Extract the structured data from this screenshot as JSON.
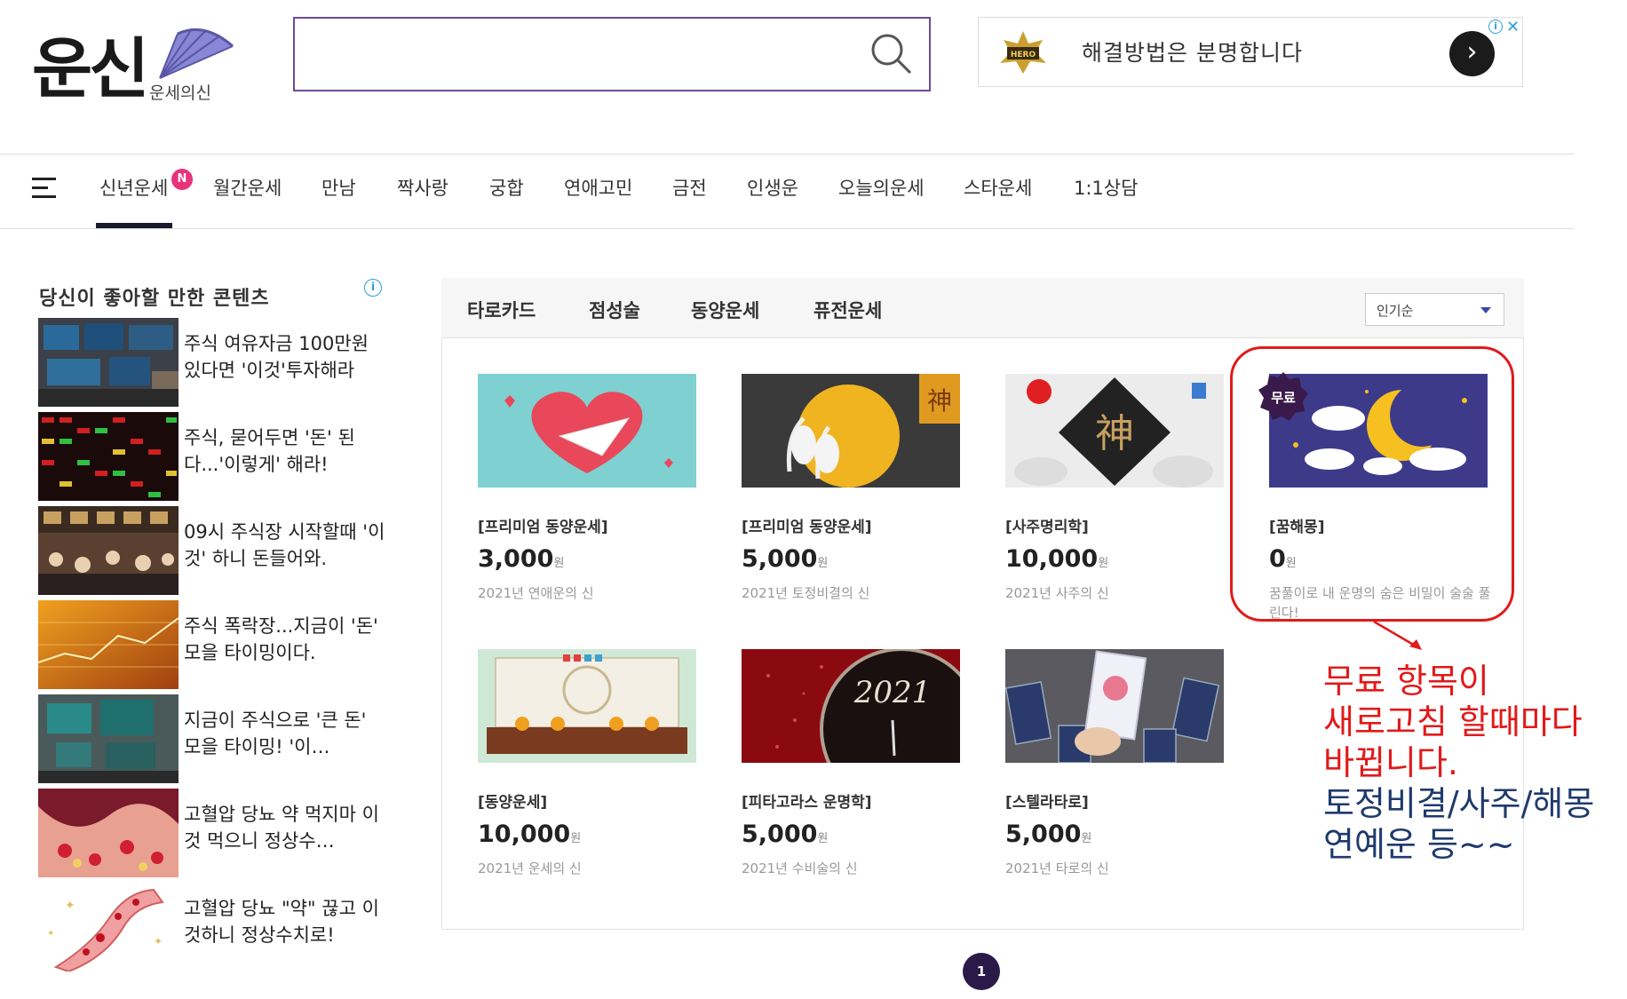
{
  "logo": {
    "text": "운신",
    "subtitle": "운세의신"
  },
  "search": {
    "placeholder": "",
    "value": ""
  },
  "ad_banner": {
    "text": "해결방법은 분명합니다",
    "info": "i",
    "close": "✕"
  },
  "nav": {
    "items": [
      "신년운세",
      "월간운세",
      "만남",
      "짝사랑",
      "궁합",
      "연애고민",
      "금전",
      "인생운",
      "오늘의운세",
      "스타운세",
      "1:1상담"
    ],
    "new_badge": "N",
    "active_index": 0
  },
  "recommendations": {
    "title": "당신이 좋아할 만한 콘텐츠",
    "items": [
      {
        "text": "주식 여유자금 100만원 있다면 '이것'투자해라"
      },
      {
        "text": "주식, 묻어두면 '돈' 된다...'이렇게' 해라!"
      },
      {
        "text": "09시 주식장 시작할때 '이것' 하니 돈들어와."
      },
      {
        "text": "주식 폭락장...지금이 '돈' 모을 타이밍이다."
      },
      {
        "text": "지금이 주식으로 '큰 돈' 모을 타이밍! '이…"
      },
      {
        "text": "고혈압 당뇨 약 먹지마 이것 먹으니 정상수…"
      },
      {
        "text": "고혈압 당뇨 \"약\" 끊고 이것하니 정상수치로!"
      }
    ]
  },
  "fortune": {
    "tabs": [
      "타로카드",
      "점성술",
      "동양운세",
      "퓨전운세"
    ],
    "sort": "인기순",
    "free_label": "무료",
    "price_unit": "원",
    "cards": [
      {
        "category": "[프리미엄 동양운세]",
        "price": "3,000",
        "desc": "2021년 연애운의 신"
      },
      {
        "category": "[프리미엄 동양운세]",
        "price": "5,000",
        "desc": "2021년 토정비결의 신"
      },
      {
        "category": "[사주명리학]",
        "price": "10,000",
        "desc": "2021년 사주의 신"
      },
      {
        "category": "[꿈해몽]",
        "price": "0",
        "desc": "꿈풀이로 내 운명의 숨은 비밀이 술술 풀린다!"
      },
      {
        "category": "[동양운세]",
        "price": "10,000",
        "desc": "2021년 운세의 신"
      },
      {
        "category": "[피타고라스 운명학]",
        "price": "5,000",
        "desc": "2021년 수비술의 신"
      },
      {
        "category": "[스텔라타로]",
        "price": "5,000",
        "desc": "2021년 타로의 신"
      }
    ]
  },
  "annotation": {
    "red_lines": [
      "무료 항목이",
      "새로고침 할때마다",
      "바뀝니다."
    ],
    "blue_lines": [
      "토정비결/사주/해몽",
      "연예운 등~~"
    ],
    "color_red": "#e21a1a",
    "color_blue": "#1f3a6e"
  },
  "pagination": {
    "current": "1"
  },
  "colors": {
    "accent": "#6a4c9c",
    "nav_active": "#1a1a2e",
    "badge": "#e8337a"
  }
}
